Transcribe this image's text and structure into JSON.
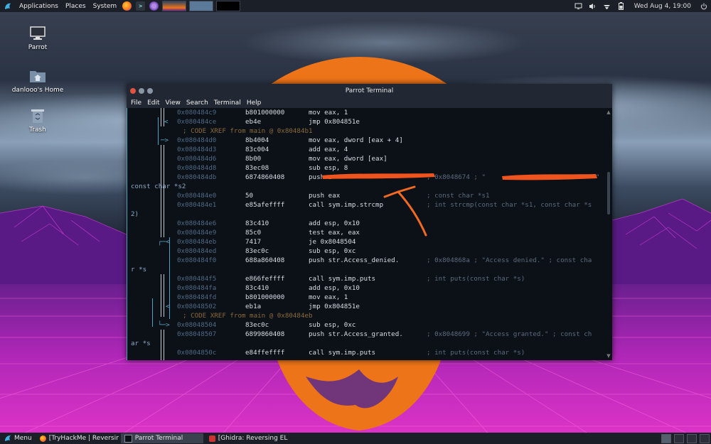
{
  "top_panel": {
    "menus": [
      "Applications",
      "Places",
      "System"
    ],
    "clock": "Wed Aug 4, 19:00",
    "launchers": [
      "firefox-icon",
      "terminal-icon",
      "tor-browser-icon"
    ],
    "tray": [
      "monitor-icon",
      "volume-icon",
      "network-icon",
      "battery-icon",
      "power-icon"
    ]
  },
  "desktop": {
    "icons": [
      {
        "label": "Parrot",
        "icon": "computer-icon"
      },
      {
        "label": "danlooo's Home",
        "icon": "home-folder-icon"
      },
      {
        "label": "Trash",
        "icon": "trash-icon"
      }
    ]
  },
  "terminal": {
    "title": "Parrot Terminal",
    "menu": [
      "File",
      "Edit",
      "View",
      "Search",
      "Terminal",
      "Help"
    ],
    "lines": [
      {
        "addr": "0x080484c9",
        "op": "b801000000",
        "ins": "mov eax, 1",
        "cmt": ""
      },
      {
        "addr": "0x080484ce",
        "op": "eb4e",
        "ins": "jmp 0x804851e",
        "cmt": ""
      },
      {
        "xref": "; CODE XREF from main @ 0x80484b1"
      },
      {
        "addr": "0x080484d0",
        "op": "8b4004",
        "ins": "mov eax, dword [eax + 4]",
        "cmt": ""
      },
      {
        "addr": "0x080484d3",
        "op": "83c004",
        "ins": "add eax, 4",
        "cmt": ""
      },
      {
        "addr": "0x080484d6",
        "op": "8b00",
        "ins": "mov eax, dword [eax]",
        "cmt": ""
      },
      {
        "addr": "0x080484d8",
        "op": "83ec08",
        "ins": "sub esp, 8",
        "cmt": ""
      },
      {
        "addr": "0x080484db",
        "op": "6874860408",
        "ins": "push s",
        "cmt": "; 0x8048674 ; \"",
        "tail": "\" ;"
      },
      {
        "wrap": "const char *s2"
      },
      {
        "addr": "0x080484e0",
        "op": "50",
        "ins": "push eax",
        "cmt": "; const char *s1"
      },
      {
        "addr": "0x080484e1",
        "op": "e85afeffff",
        "ins": "call sym.imp.strcmp",
        "cmt": "; int strcmp(const char *s1, const char *s"
      },
      {
        "wrap": "2)"
      },
      {
        "addr": "0x080484e6",
        "op": "83c410",
        "ins": "add esp, 0x10",
        "cmt": ""
      },
      {
        "addr": "0x080484e9",
        "op": "85c0",
        "ins": "test eax, eax",
        "cmt": ""
      },
      {
        "addr": "0x080484eb",
        "op": "7417",
        "ins": "je 0x8048504",
        "cmt": ""
      },
      {
        "addr": "0x080484ed",
        "op": "83ec0c",
        "ins": "sub esp, 0xc",
        "cmt": ""
      },
      {
        "addr": "0x080484f0",
        "op": "688a860408",
        "ins": "push str.Access_denied.",
        "cmt": "; 0x804868a ; \"Access denied.\" ; const cha"
      },
      {
        "wrap": "r *s"
      },
      {
        "addr": "0x080484f5",
        "op": "e866feffff",
        "ins": "call sym.imp.puts",
        "cmt": "; int puts(const char *s)"
      },
      {
        "addr": "0x080484fa",
        "op": "83c410",
        "ins": "add esp, 0x10",
        "cmt": ""
      },
      {
        "addr": "0x080484fd",
        "op": "b801000000",
        "ins": "mov eax, 1",
        "cmt": ""
      },
      {
        "addr": "0x08048502",
        "op": "eb1a",
        "ins": "jmp 0x804851e",
        "cmt": ""
      },
      {
        "xref": "; CODE XREF from main @ 0x80484eb"
      },
      {
        "addr": "0x08048504",
        "op": "83ec0c",
        "ins": "sub esp, 0xc",
        "cmt": ""
      },
      {
        "addr": "0x08048507",
        "op": "6899860408",
        "ins": "push str.Access_granted.",
        "cmt": "; 0x8048699 ; \"Access granted.\" ; const ch"
      },
      {
        "wrap": "ar *s"
      },
      {
        "addr": "0x0804850c",
        "op": "e84ffeffff",
        "ins": "call sym.imp.puts",
        "cmt": "; int puts(const char *s)"
      }
    ]
  },
  "bottom_panel": {
    "menu_label": "Menu",
    "tasks": [
      {
        "label": "[TryHackMe | Reversin...",
        "icon": "firefox-icon",
        "active": false
      },
      {
        "label": "Parrot Terminal",
        "icon": "terminal-icon",
        "active": true
      },
      {
        "label": "[Ghidra: Reversing ELF...",
        "icon": "ghidra-icon",
        "active": false
      }
    ]
  },
  "colors": {
    "panel": "#1b1f27",
    "terminal_bg": "#0c1017",
    "address": "#4e6a86",
    "annotation_red": "#e8501e"
  }
}
